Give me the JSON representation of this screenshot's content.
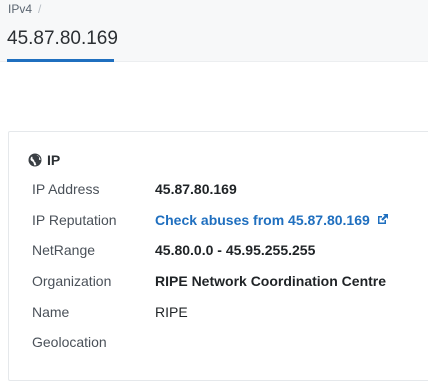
{
  "breadcrumb": {
    "item": "IPv4",
    "separator": "/"
  },
  "page": {
    "title": "45.87.80.169"
  },
  "card": {
    "title": "IP",
    "icon": "globe-icon",
    "rows": [
      {
        "label": "IP Address",
        "value": "45.87.80.169"
      },
      {
        "label": "IP Reputation",
        "value": "Check abuses from 45.87.80.169",
        "icon": "external-link-icon"
      },
      {
        "label": "NetRange",
        "value": "45.80.0.0 - 45.95.255.255"
      },
      {
        "label": "Organization",
        "value": "RIPE Network Coordination Centre"
      },
      {
        "label": "Name",
        "value": "RIPE"
      },
      {
        "label": "Geolocation",
        "value": ""
      }
    ]
  },
  "colors": {
    "accent": "#1f6fbf",
    "header_bg": "#f7f8f9"
  }
}
